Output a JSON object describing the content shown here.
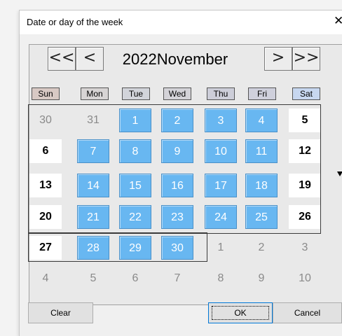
{
  "window": {
    "title": "Date or day of the week",
    "close_glyph": "✕"
  },
  "nav": {
    "prev_year": "<<",
    "prev_month": "<",
    "next_month": ">",
    "next_year": ">>",
    "month_label": "2022November"
  },
  "weekdays": [
    {
      "label": "Sun",
      "bg": "#d8c9c4"
    },
    {
      "label": "Mon",
      "bg": "#d7d4d4"
    },
    {
      "label": "Tue",
      "bg": "#d2d4da"
    },
    {
      "label": "Wed",
      "bg": "#d4d3d8"
    },
    {
      "label": "Thu",
      "bg": "#cdced9"
    },
    {
      "label": "Fri",
      "bg": "#cfd0dc"
    },
    {
      "label": "Sat",
      "bg": "#c7d7f0"
    }
  ],
  "weeks": [
    [
      {
        "d": "30",
        "t": "out"
      },
      {
        "d": "31",
        "t": "out"
      },
      {
        "d": "1",
        "t": "blue"
      },
      {
        "d": "2",
        "t": "blue"
      },
      {
        "d": "3",
        "t": "blue"
      },
      {
        "d": "4",
        "t": "blue"
      },
      {
        "d": "5",
        "t": "white"
      }
    ],
    [
      {
        "d": "6",
        "t": "white"
      },
      {
        "d": "7",
        "t": "blue"
      },
      {
        "d": "8",
        "t": "blue"
      },
      {
        "d": "9",
        "t": "blue"
      },
      {
        "d": "10",
        "t": "blue"
      },
      {
        "d": "11",
        "t": "blue"
      },
      {
        "d": "12",
        "t": "white"
      }
    ],
    [
      {
        "d": "13",
        "t": "white"
      },
      {
        "d": "14",
        "t": "blue"
      },
      {
        "d": "15",
        "t": "blue"
      },
      {
        "d": "16",
        "t": "blue"
      },
      {
        "d": "17",
        "t": "blue"
      },
      {
        "d": "18",
        "t": "blue"
      },
      {
        "d": "19",
        "t": "white"
      }
    ],
    [
      {
        "d": "20",
        "t": "white"
      },
      {
        "d": "21",
        "t": "blue"
      },
      {
        "d": "22",
        "t": "blue"
      },
      {
        "d": "23",
        "t": "blue"
      },
      {
        "d": "24",
        "t": "blue"
      },
      {
        "d": "25",
        "t": "blue"
      },
      {
        "d": "26",
        "t": "white"
      }
    ],
    [
      {
        "d": "27",
        "t": "white"
      },
      {
        "d": "28",
        "t": "blue"
      },
      {
        "d": "29",
        "t": "blue"
      },
      {
        "d": "30",
        "t": "blue"
      },
      {
        "d": "1",
        "t": "out"
      },
      {
        "d": "2",
        "t": "out"
      },
      {
        "d": "3",
        "t": "out"
      }
    ],
    [
      {
        "d": "4",
        "t": "out"
      },
      {
        "d": "5",
        "t": "out"
      },
      {
        "d": "6",
        "t": "out"
      },
      {
        "d": "7",
        "t": "out"
      },
      {
        "d": "8",
        "t": "out"
      },
      {
        "d": "9",
        "t": "out"
      },
      {
        "d": "10",
        "t": "out"
      }
    ]
  ],
  "buttons": {
    "clear": "Clear",
    "ok": "OK",
    "cancel": "Cancel"
  }
}
